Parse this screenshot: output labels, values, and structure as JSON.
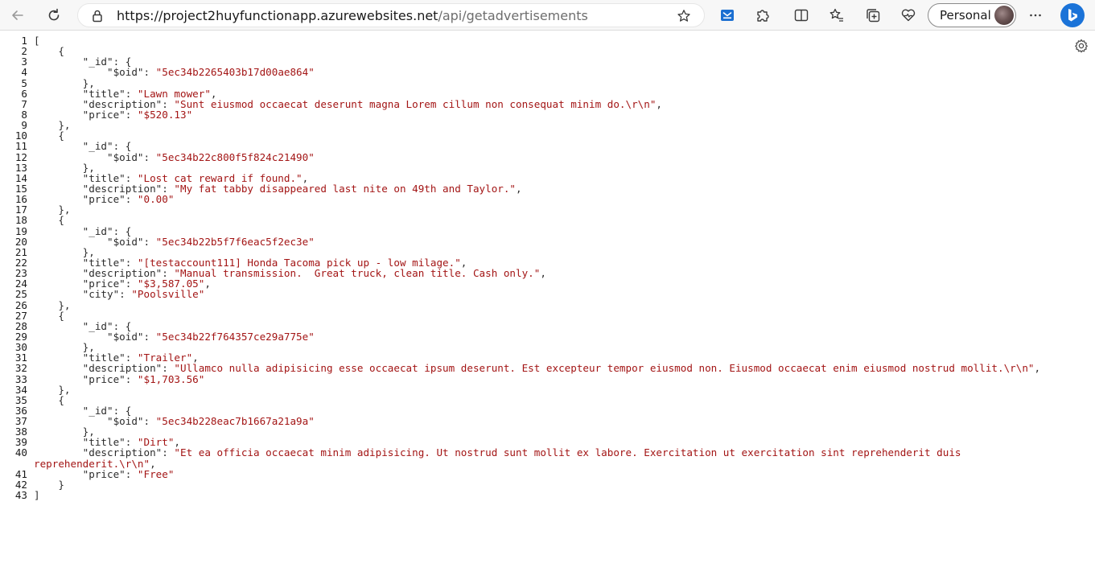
{
  "browser": {
    "url_host": "https://project2huyfunctionapp.azurewebsites.net",
    "url_path": "/api/getadvertisements",
    "profile_label": "Personal"
  },
  "json_lines": [
    {
      "n": "1",
      "i": "",
      "k": "",
      "v": "",
      "p": "["
    },
    {
      "n": "2",
      "i": "    ",
      "k": "",
      "v": "",
      "p": "{"
    },
    {
      "n": "3",
      "i": "        ",
      "k": "\"_id\"",
      "v": "",
      "p": ": {"
    },
    {
      "n": "4",
      "i": "            ",
      "k": "\"$oid\"",
      "v": "\"5ec34b2265403b17d00ae864\"",
      "p": ""
    },
    {
      "n": "5",
      "i": "        ",
      "k": "",
      "v": "",
      "p": "},"
    },
    {
      "n": "6",
      "i": "        ",
      "k": "\"title\"",
      "v": "\"Lawn mower\"",
      "p": ","
    },
    {
      "n": "7",
      "i": "        ",
      "k": "\"description\"",
      "v": "\"Sunt eiusmod occaecat deserunt magna Lorem cillum non consequat minim do.\\r\\n\"",
      "p": ","
    },
    {
      "n": "8",
      "i": "        ",
      "k": "\"price\"",
      "v": "\"$520.13\"",
      "p": ""
    },
    {
      "n": "9",
      "i": "    ",
      "k": "",
      "v": "",
      "p": "},"
    },
    {
      "n": "10",
      "i": "    ",
      "k": "",
      "v": "",
      "p": "{"
    },
    {
      "n": "11",
      "i": "        ",
      "k": "\"_id\"",
      "v": "",
      "p": ": {"
    },
    {
      "n": "12",
      "i": "            ",
      "k": "\"$oid\"",
      "v": "\"5ec34b22c800f5f824c21490\"",
      "p": ""
    },
    {
      "n": "13",
      "i": "        ",
      "k": "",
      "v": "",
      "p": "},"
    },
    {
      "n": "14",
      "i": "        ",
      "k": "\"title\"",
      "v": "\"Lost cat reward if found.\"",
      "p": ","
    },
    {
      "n": "15",
      "i": "        ",
      "k": "\"description\"",
      "v": "\"My fat tabby disappeared last nite on 49th and Taylor.\"",
      "p": ","
    },
    {
      "n": "16",
      "i": "        ",
      "k": "\"price\"",
      "v": "\"0.00\"",
      "p": ""
    },
    {
      "n": "17",
      "i": "    ",
      "k": "",
      "v": "",
      "p": "},"
    },
    {
      "n": "18",
      "i": "    ",
      "k": "",
      "v": "",
      "p": "{"
    },
    {
      "n": "19",
      "i": "        ",
      "k": "\"_id\"",
      "v": "",
      "p": ": {"
    },
    {
      "n": "20",
      "i": "            ",
      "k": "\"$oid\"",
      "v": "\"5ec34b22b5f7f6eac5f2ec3e\"",
      "p": ""
    },
    {
      "n": "21",
      "i": "        ",
      "k": "",
      "v": "",
      "p": "},"
    },
    {
      "n": "22",
      "i": "        ",
      "k": "\"title\"",
      "v": "\"[testaccount111] Honda Tacoma pick up - low milage.\"",
      "p": ","
    },
    {
      "n": "23",
      "i": "        ",
      "k": "\"description\"",
      "v": "\"Manual transmission.  Great truck, clean title. Cash only.\"",
      "p": ","
    },
    {
      "n": "24",
      "i": "        ",
      "k": "\"price\"",
      "v": "\"$3,587.05\"",
      "p": ","
    },
    {
      "n": "25",
      "i": "        ",
      "k": "\"city\"",
      "v": "\"Poolsville\"",
      "p": ""
    },
    {
      "n": "26",
      "i": "    ",
      "k": "",
      "v": "",
      "p": "},"
    },
    {
      "n": "27",
      "i": "    ",
      "k": "",
      "v": "",
      "p": "{"
    },
    {
      "n": "28",
      "i": "        ",
      "k": "\"_id\"",
      "v": "",
      "p": ": {"
    },
    {
      "n": "29",
      "i": "            ",
      "k": "\"$oid\"",
      "v": "\"5ec34b22f764357ce29a775e\"",
      "p": ""
    },
    {
      "n": "30",
      "i": "        ",
      "k": "",
      "v": "",
      "p": "},"
    },
    {
      "n": "31",
      "i": "        ",
      "k": "\"title\"",
      "v": "\"Trailer\"",
      "p": ","
    },
    {
      "n": "32",
      "i": "        ",
      "k": "\"description\"",
      "v": "\"Ullamco nulla adipisicing esse occaecat ipsum deserunt. Est excepteur tempor eiusmod non. Eiusmod occaecat enim eiusmod nostrud mollit.\\r\\n\"",
      "p": ","
    },
    {
      "n": "33",
      "i": "        ",
      "k": "\"price\"",
      "v": "\"$1,703.56\"",
      "p": ""
    },
    {
      "n": "34",
      "i": "    ",
      "k": "",
      "v": "",
      "p": "},"
    },
    {
      "n": "35",
      "i": "    ",
      "k": "",
      "v": "",
      "p": "{"
    },
    {
      "n": "36",
      "i": "        ",
      "k": "\"_id\"",
      "v": "",
      "p": ": {"
    },
    {
      "n": "37",
      "i": "            ",
      "k": "\"$oid\"",
      "v": "\"5ec34b228eac7b1667a21a9a\"",
      "p": ""
    },
    {
      "n": "38",
      "i": "        ",
      "k": "",
      "v": "",
      "p": "},"
    },
    {
      "n": "39",
      "i": "        ",
      "k": "\"title\"",
      "v": "\"Dirt\"",
      "p": ","
    },
    {
      "n": "40",
      "i": "        ",
      "k": "\"description\"",
      "v": "\"Et ea officia occaecat minim adipisicing. Ut nostrud sunt mollit ex labore. Exercitation ut exercitation sint reprehenderit duis",
      "p": ""
    },
    {
      "n": "",
      "i": "",
      "k": "",
      "v": "reprehenderit.\\r\\n\"",
      "p": ","
    },
    {
      "n": "41",
      "i": "        ",
      "k": "\"price\"",
      "v": "\"Free\"",
      "p": ""
    },
    {
      "n": "42",
      "i": "    ",
      "k": "",
      "v": "",
      "p": "}"
    },
    {
      "n": "43",
      "i": "",
      "k": "",
      "v": "",
      "p": "]"
    }
  ],
  "colors": {
    "string_value": "#a31515",
    "key": "#2c2c2c",
    "bing_brand": "#1b73d8"
  },
  "icons": [
    "back-arrow-icon",
    "refresh-icon",
    "lock-icon",
    "favorite-star-icon",
    "reading-view-icon",
    "extensions-icon",
    "split-screen-icon",
    "favorites-icon",
    "collections-icon",
    "browser-essentials-icon",
    "more-options-icon",
    "bing-copilot-icon",
    "json-settings-icon"
  ]
}
